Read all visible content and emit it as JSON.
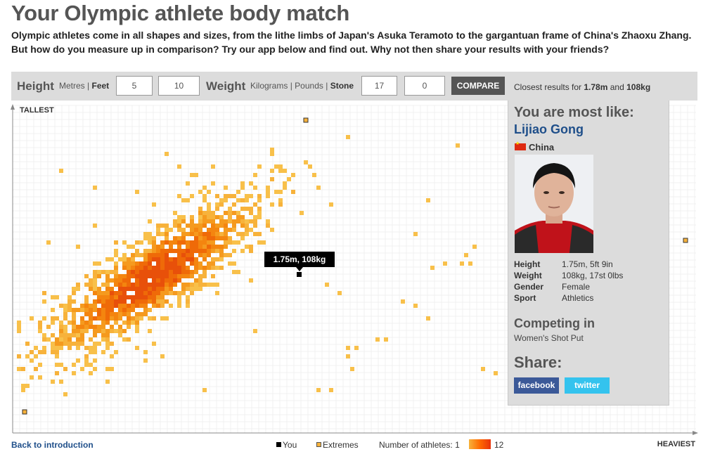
{
  "title": "Your Olympic athlete body match",
  "intro": "Olympic athletes come in all shapes and sizes, from the lithe limbs of Japan's Asuka Teramoto to the gargantuan frame of China's Zhaoxu Zhang. But how do you measure up in comparison? Try our app below and find out. Why not then share your results with your friends?",
  "toolbar": {
    "height_label": "Height",
    "height_units": {
      "metres": "Metres",
      "separator": "|",
      "feet": "Feet"
    },
    "height_feet_value": "5",
    "height_inches_value": "10",
    "weight_label": "Weight",
    "weight_units": {
      "kilograms": "Kilograms",
      "separator1": "|",
      "pounds": "Pounds",
      "separator2": "|",
      "stone": "Stone"
    },
    "weight_stone_value": "17",
    "weight_pounds_value": "0",
    "compare_label": "COMPARE",
    "closest_prefix": "Closest results for",
    "closest_height": "1.78m",
    "closest_and": "and",
    "closest_weight": "108kg"
  },
  "chart_labels": {
    "tallest": "TALLEST",
    "heaviest": "HEAVIEST",
    "you_tooltip": "1.75m, 108kg"
  },
  "panel": {
    "most_like": "You are most like:",
    "athlete_name": "Lijiao Gong",
    "country": "China",
    "stats": [
      {
        "key": "Height",
        "value": "1.75m, 5ft 9in"
      },
      {
        "key": "Weight",
        "value": "108kg, 17st 0lbs"
      },
      {
        "key": "Gender",
        "value": "Female"
      },
      {
        "key": "Sport",
        "value": "Athletics"
      }
    ],
    "competing_title": "Competing in",
    "event": "Women's Shot Put",
    "share_title": "Share:",
    "facebook_label": "facebook",
    "twitter_label": "twitter"
  },
  "footer": {
    "back_link": "Back to introduction",
    "legend_you": "You",
    "legend_extremes": "Extremes",
    "legend_count_label": "Number of athletes:",
    "legend_min": "1",
    "legend_max": "12"
  },
  "colors": {
    "you": "#000000",
    "extremes": "#f7b23b",
    "count_low": "#f7b23b",
    "count_high": "#e8320a",
    "link": "#1f4f8a"
  }
}
